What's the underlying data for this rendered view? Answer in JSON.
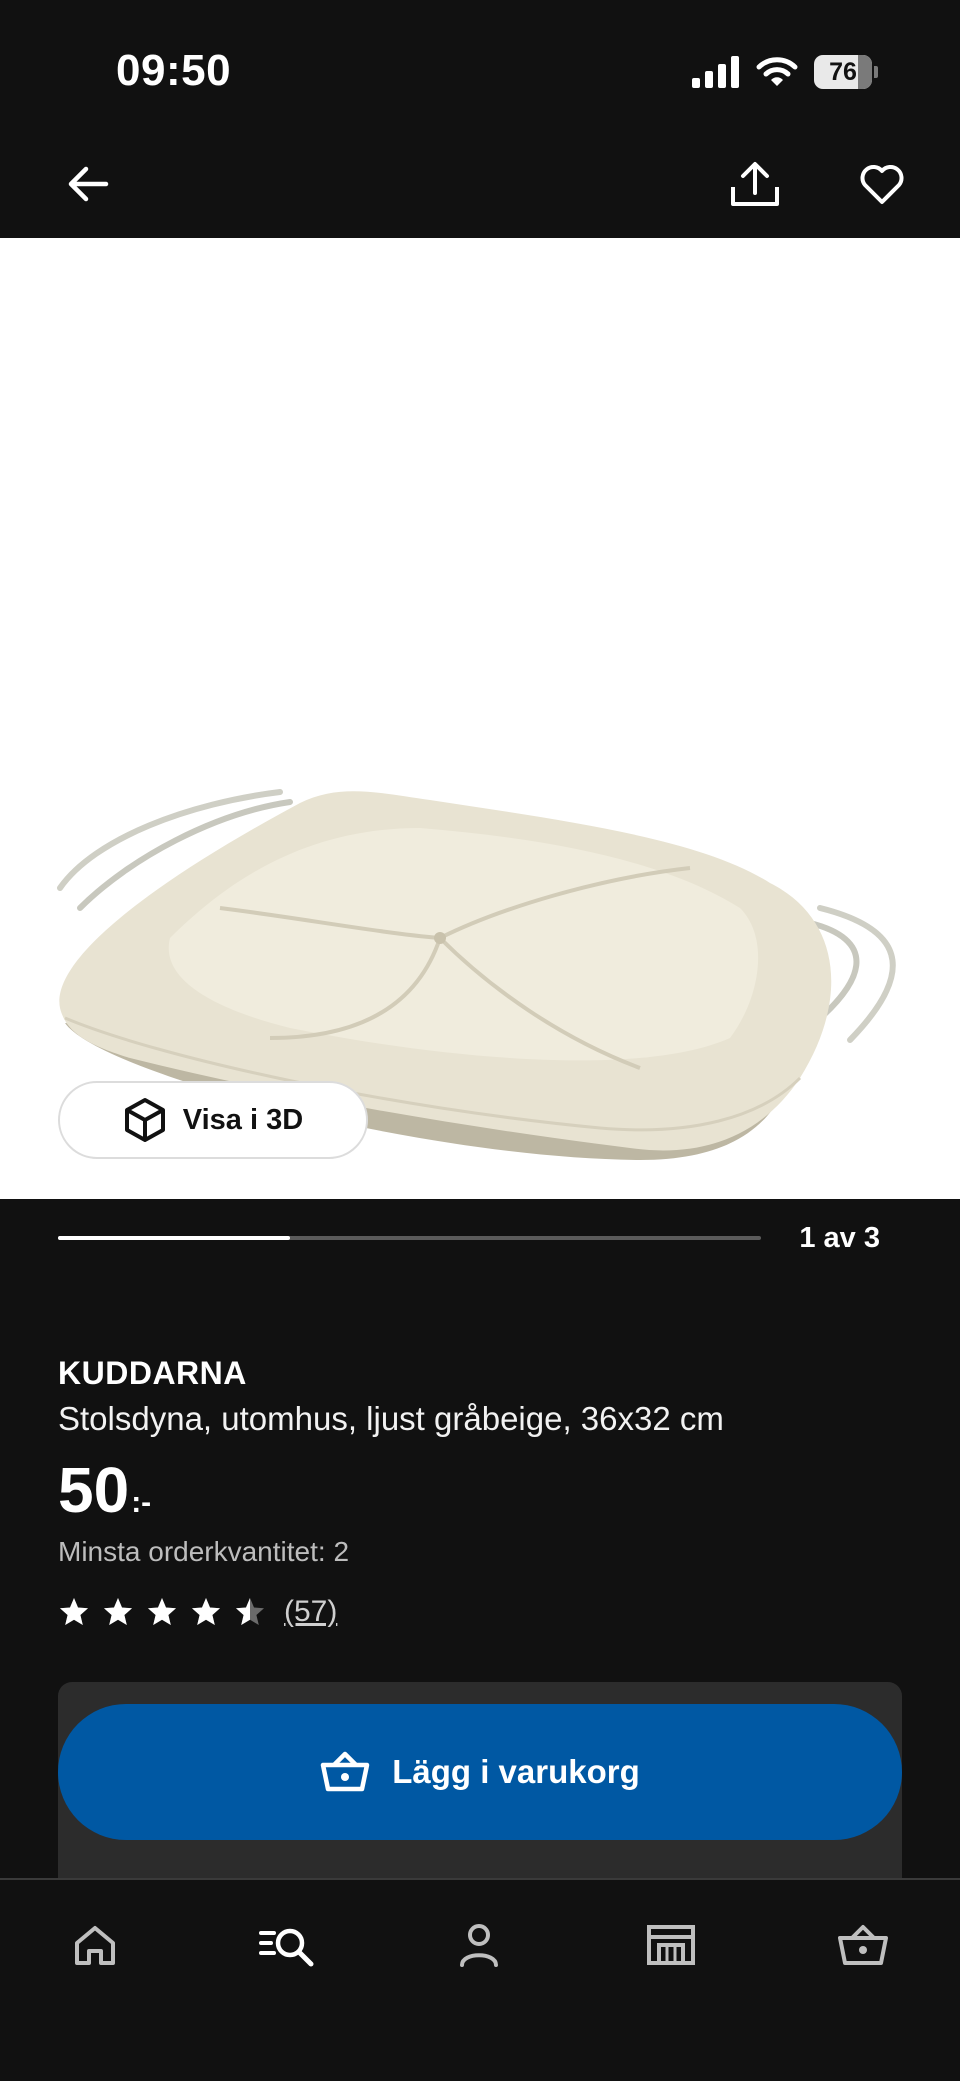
{
  "status_bar": {
    "time": "09:50",
    "battery": "76"
  },
  "gallery": {
    "view_3d_label": "Visa i 3D",
    "page_indicator": "1 av 3",
    "progress": 0.33
  },
  "product": {
    "brand": "KUDDARNA",
    "description": "Stolsdyna, utomhus, ljust gråbeige, 36x32 cm",
    "price": "50",
    "price_suffix": ":-",
    "min_order": "Minsta orderkvantitet: 2",
    "rating": 4.5,
    "review_count": "(57)"
  },
  "actions": {
    "add_to_cart": "Lägg i varukorg"
  },
  "colors": {
    "accent": "#0058a3",
    "background": "#111111"
  },
  "icons": {
    "top_nav": [
      "back-arrow-icon",
      "share-icon",
      "heart-icon"
    ],
    "bottom_nav": [
      "home-icon",
      "search-icon",
      "profile-icon",
      "store-icon",
      "cart-icon"
    ]
  }
}
